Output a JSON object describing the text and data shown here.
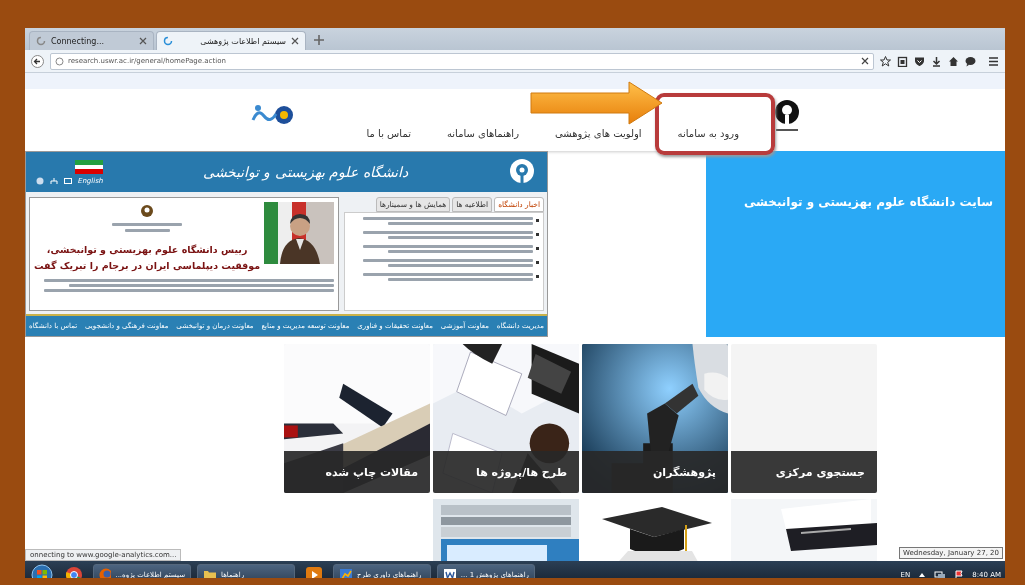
{
  "browser": {
    "tabs": [
      {
        "label": "سیستم اطلاعات پژوهشی",
        "selected": true
      },
      {
        "label": "Connecting...",
        "selected": false
      }
    ],
    "url": "research.uswr.ac.ir/general/homePage.action"
  },
  "site_nav": {
    "items": [
      {
        "label": "ورود به سامانه",
        "highlighted": true
      },
      {
        "label": "اولویت های پژوهشی",
        "highlighted": false
      },
      {
        "label": "راهنماهای سامانه",
        "highlighted": false
      },
      {
        "label": "تماس با ما",
        "highlighted": false
      }
    ]
  },
  "news_site": {
    "title": "دانشگاه علوم بهزیستی و توانبخشی",
    "language_link": "English",
    "headline": [
      "رییس دانشگاه علوم بهزیستی و توانبخشی،",
      "موفقیت دیپلماسی ایران در برجام  را تبریک گفت"
    ],
    "tabs": [
      {
        "label": "اخبار دانشگاه",
        "selected": true
      },
      {
        "label": "اطلاعیه ها",
        "selected": false
      },
      {
        "label": "همایش ها و سمینارها",
        "selected": false
      }
    ],
    "menu": [
      "مدیریت دانشگاه",
      "معاونت آموزشی",
      "معاونت تحقیقات و فناوری",
      "معاونت توسعه مدیریت و منابع",
      "معاونت درمان و توانبخشی",
      "معاونت فرهنگی و دانشجویی",
      "تماس با دانشگاه"
    ]
  },
  "info_panel": {
    "text": "سایت دانشگاه علوم بهزیستی و توانبخشی"
  },
  "tiles": [
    {
      "label": "جستجوی مرکزی",
      "kind": "plain"
    },
    {
      "label": "پژوهشگران",
      "kind": "picture"
    },
    {
      "label": "طرح ها/پروژه ها",
      "kind": "picture"
    },
    {
      "label": "مقالات چاپ شده",
      "kind": "picture"
    }
  ],
  "status_text": "onnecting to www.google-analytics.com...",
  "taskbar": {
    "buttons": [
      {
        "label": "راهنماهای پژوهش 1 ...",
        "kind": "word"
      },
      {
        "label": "راهنماهای داوری طرح",
        "kind": "app"
      },
      {
        "label": "راهنماها",
        "kind": "folder"
      },
      {
        "label": "سیستم اطلاعات پژوه...",
        "kind": "firefox"
      }
    ],
    "language": "EN",
    "time": "8:40 AM",
    "date_tooltip": "Wednesday, January 27, 20"
  }
}
